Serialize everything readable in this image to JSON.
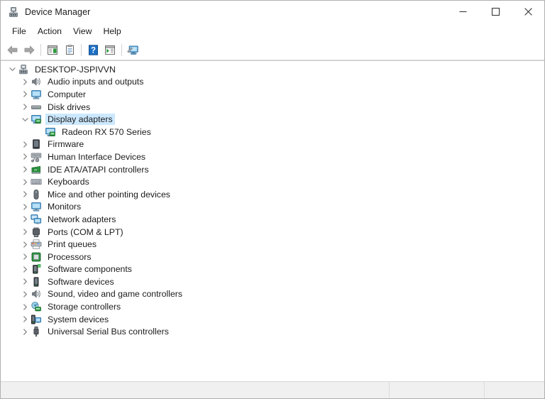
{
  "window": {
    "title": "Device Manager",
    "icon": "device-manager-icon",
    "controls": {
      "minimize": "─",
      "maximize": "☐",
      "close": "✕"
    }
  },
  "menubar": {
    "items": [
      {
        "label": "File"
      },
      {
        "label": "Action"
      },
      {
        "label": "View"
      },
      {
        "label": "Help"
      }
    ]
  },
  "toolbar": {
    "buttons": [
      {
        "name": "back-arrow-icon",
        "tooltip": "Back"
      },
      {
        "name": "forward-arrow-icon",
        "tooltip": "Forward"
      },
      {
        "name": "separator-1",
        "tooltip": ""
      },
      {
        "name": "show-hide-console-tree-icon",
        "tooltip": "Show/Hide Console Tree"
      },
      {
        "name": "properties-icon",
        "tooltip": "Properties"
      },
      {
        "name": "separator-2",
        "tooltip": ""
      },
      {
        "name": "help-icon",
        "tooltip": "Help"
      },
      {
        "name": "scan-for-hardware-changes-icon",
        "tooltip": "Scan for hardware changes"
      },
      {
        "name": "separator-3",
        "tooltip": ""
      },
      {
        "name": "update-driver-icon",
        "tooltip": "Update driver"
      }
    ]
  },
  "tree": {
    "root": {
      "label": "DESKTOP-JSPIVVN",
      "icon": "computer-node-icon",
      "expanded": true,
      "twisty": "chevron-down",
      "indent": 0,
      "selected": false
    },
    "items": [
      {
        "label": "Audio inputs and outputs",
        "icon": "speaker-icon",
        "twisty": "chevron-right",
        "indent": 1,
        "selected": false
      },
      {
        "label": "Computer",
        "icon": "monitor-icon",
        "twisty": "chevron-right",
        "indent": 1,
        "selected": false
      },
      {
        "label": "Disk drives",
        "icon": "disk-drive-icon",
        "twisty": "chevron-right",
        "indent": 1,
        "selected": false
      },
      {
        "label": "Display adapters",
        "icon": "display-adapter-icon",
        "twisty": "chevron-down",
        "indent": 1,
        "selected": true
      },
      {
        "label": "Radeon RX 570 Series",
        "icon": "display-adapter-icon",
        "twisty": "none",
        "indent": 2,
        "selected": false
      },
      {
        "label": "Firmware",
        "icon": "firmware-icon",
        "twisty": "chevron-right",
        "indent": 1,
        "selected": false
      },
      {
        "label": "Human Interface Devices",
        "icon": "hid-icon",
        "twisty": "chevron-right",
        "indent": 1,
        "selected": false
      },
      {
        "label": "IDE ATA/ATAPI controllers",
        "icon": "ide-controller-icon",
        "twisty": "chevron-right",
        "indent": 1,
        "selected": false
      },
      {
        "label": "Keyboards",
        "icon": "keyboard-icon",
        "twisty": "chevron-right",
        "indent": 1,
        "selected": false
      },
      {
        "label": "Mice and other pointing devices",
        "icon": "mouse-icon",
        "twisty": "chevron-right",
        "indent": 1,
        "selected": false
      },
      {
        "label": "Monitors",
        "icon": "monitor-icon",
        "twisty": "chevron-right",
        "indent": 1,
        "selected": false
      },
      {
        "label": "Network adapters",
        "icon": "network-adapter-icon",
        "twisty": "chevron-right",
        "indent": 1,
        "selected": false
      },
      {
        "label": "Ports (COM & LPT)",
        "icon": "port-icon",
        "twisty": "chevron-right",
        "indent": 1,
        "selected": false
      },
      {
        "label": "Print queues",
        "icon": "printer-icon",
        "twisty": "chevron-right",
        "indent": 1,
        "selected": false
      },
      {
        "label": "Processors",
        "icon": "processor-icon",
        "twisty": "chevron-right",
        "indent": 1,
        "selected": false
      },
      {
        "label": "Software components",
        "icon": "software-component-icon",
        "twisty": "chevron-right",
        "indent": 1,
        "selected": false
      },
      {
        "label": "Software devices",
        "icon": "software-device-icon",
        "twisty": "chevron-right",
        "indent": 1,
        "selected": false
      },
      {
        "label": "Sound, video and game controllers",
        "icon": "speaker-icon",
        "twisty": "chevron-right",
        "indent": 1,
        "selected": false
      },
      {
        "label": "Storage controllers",
        "icon": "storage-controller-icon",
        "twisty": "chevron-right",
        "indent": 1,
        "selected": false
      },
      {
        "label": "System devices",
        "icon": "system-device-icon",
        "twisty": "chevron-right",
        "indent": 1,
        "selected": false
      },
      {
        "label": "Universal Serial Bus controllers",
        "icon": "usb-icon",
        "twisty": "chevron-right",
        "indent": 1,
        "selected": false
      }
    ]
  },
  "statusbar": {
    "pane1": "",
    "pane2": "",
    "pane3": ""
  },
  "colors": {
    "selection": "#cce8ff",
    "window_border": "#b0b0b0",
    "statusbar_bg": "#f0f0f0",
    "text": "#1b1b1b",
    "twisty": "#8b8b8b"
  }
}
